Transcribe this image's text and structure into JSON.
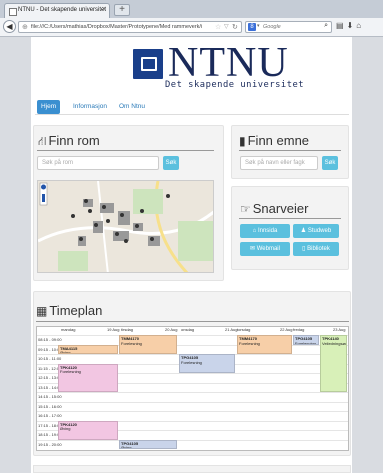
{
  "browser": {
    "tab_title": "NTNU - Det skapende universitet",
    "new_tab": "+",
    "url": "file:///C:/Users/mathias/Dropbox/Master/Prototypene/Med rammeverk/i",
    "search_placeholder": "Google",
    "search_engine": "8"
  },
  "header": {
    "logo_text": "NTNU",
    "tagline": "Det skapende universitet"
  },
  "nav": {
    "items": [
      "Hjem",
      "Informasjon",
      "Om Ntnu"
    ]
  },
  "finn_rom": {
    "title": "Finn rom",
    "placeholder": "Søk på rom",
    "button": "Søk"
  },
  "finn_emne": {
    "title": "Finn emne",
    "placeholder": "Søk på navn eller fagk",
    "button": "Søk"
  },
  "snarveier": {
    "title": "Snarveier",
    "buttons": [
      "Innsida",
      "Studweb",
      "Webmail",
      "Bibliotek"
    ]
  },
  "timeplan": {
    "title": "Timeplan",
    "days": [
      "mandag",
      "19 Aug",
      "tirsdag",
      "20 Aug",
      "onsdag",
      "21 Aug",
      "torsdag",
      "22 Aug",
      "fredag",
      "23 Aug"
    ],
    "times": [
      "08:15 - 09:00",
      "09:15 - 10:00",
      "10:15 - 11:00",
      "11:15 - 12:00",
      "12:15 - 13:00",
      "13:15 - 14:00",
      "14:15 - 15:00",
      "15:15 - 16:00",
      "16:15 - 17:00",
      "17:15 - 18:00",
      "18:15 - 19:00",
      "19:15 - 20:00"
    ],
    "events": [
      {
        "code": "TMM4170",
        "type": "Forelesning"
      },
      {
        "code": "TMA4115",
        "type": "Øving"
      },
      {
        "code": "TPK4120",
        "type": "Forelesning"
      },
      {
        "code": "TPG4105",
        "type": "Forelesning"
      },
      {
        "code": "TMM4170",
        "type": "Forelesning"
      },
      {
        "code": "TPG4105",
        "type": "Forelesning"
      },
      {
        "code": "TPK4140",
        "type": "Veiledningsøving"
      },
      {
        "code": "TPK4120",
        "type": "Øving"
      },
      {
        "code": "TPG4105",
        "type": "Øving"
      }
    ]
  },
  "colors": {
    "accent": "#3a8fd0",
    "button": "#5bc0de",
    "logo": "#1a3f8a",
    "ev_orange": "#f7cfa8",
    "ev_blue": "#c9d4ea",
    "ev_pink": "#f2c6e2",
    "ev_green": "#d8f0b8"
  }
}
